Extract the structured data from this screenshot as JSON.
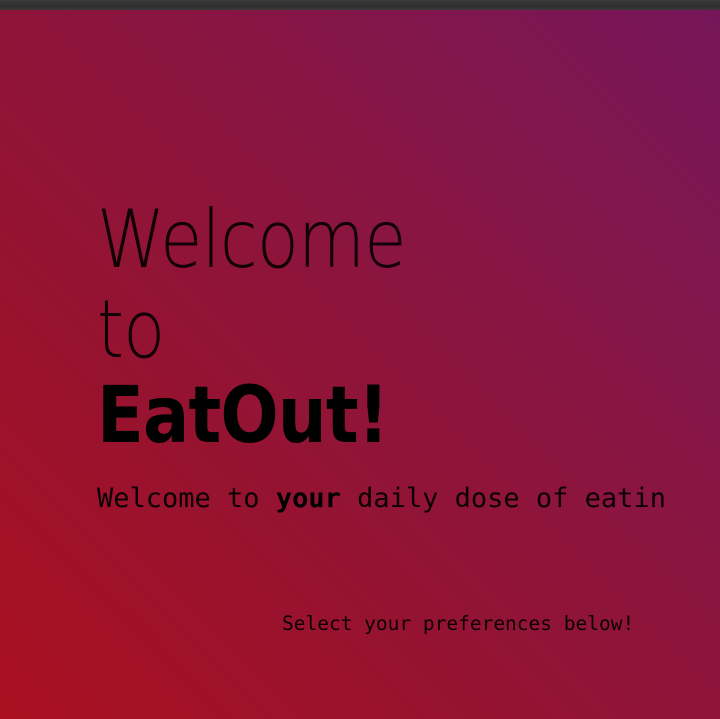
{
  "hero": {
    "line1": "Welcome",
    "line2": "to",
    "brand": "EatOut!"
  },
  "tagline": {
    "before": "Welcome to ",
    "emphasis": "your",
    "after": " daily dose of eatin"
  },
  "prompt": "Select your preferences below!",
  "colors": {
    "gradient_top_right": "#76165a",
    "gradient_bottom_left": "#aa1020",
    "text": "#000000"
  }
}
